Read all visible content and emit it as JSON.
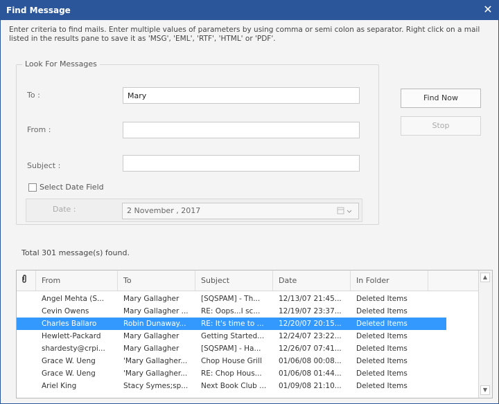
{
  "window": {
    "title": "Find Message",
    "close_glyph": "✕",
    "description": "Enter criteria to find mails. Enter multiple values of parameters by using comma or semi colon as separator. Right click on a mail listed in the results pane to save it as 'MSG', 'EML', 'RTF', 'HTML' or 'PDF'."
  },
  "search": {
    "group_title": "Look For Messages",
    "to_label": "To :",
    "to_value": "Mary",
    "from_label": "From :",
    "from_value": "",
    "subject_label": "Subject :",
    "subject_value": "",
    "date_checkbox_label": "Select Date Field",
    "date_checked": false,
    "date_label": "Date :",
    "date_value": "2 November , 2017",
    "date_picker_icon": "calendar-dropdown-icon"
  },
  "buttons": {
    "find_now": "Find Now",
    "stop": "Stop"
  },
  "results": {
    "status": "Total 301 message(s) found.",
    "columns": [
      "",
      "From",
      "To",
      "Subject",
      "Date",
      "In Folder"
    ],
    "attachment_icon": "paperclip-icon",
    "rows": [
      {
        "from": "Angel Mehta (S...",
        "to": "Mary Gallagher",
        "subject": "[SQSPAM] - Th...",
        "date": "12/13/07 21:45...",
        "folder": "Deleted Items"
      },
      {
        "from": "Cevin Owens",
        "to": "Mary Gallagher ...",
        "subject": "RE: Oops...I sc...",
        "date": "12/19/07 23:37...",
        "folder": "Deleted Items"
      },
      {
        "from": "Charles Ballaro",
        "to": "Robin Dunaway...",
        "subject": "RE: It's time to ...",
        "date": "12/20/07 20:15...",
        "folder": "Deleted Items"
      },
      {
        "from": "Hewlett-Packard",
        "to": "Mary Gallagher",
        "subject": "Getting Started...",
        "date": "12/24/07 23:22...",
        "folder": "Deleted Items"
      },
      {
        "from": "shardesty@crpi...",
        "to": "Mary Gallagher",
        "subject": "[SQSPAM] - Ha...",
        "date": "12/26/07 07:41...",
        "folder": "Deleted Items"
      },
      {
        "from": "Grace W. Ueng",
        "to": "'Mary Gallagher...",
        "subject": "Chop House Grill",
        "date": "01/06/08 00:08...",
        "folder": "Deleted Items"
      },
      {
        "from": "Grace W. Ueng",
        "to": "'Mary Gallagher...",
        "subject": "RE: Chop Hous...",
        "date": "01/06/08 01:44...",
        "folder": "Deleted Items"
      },
      {
        "from": "Ariel King",
        "to": "Stacy Symes;sp...",
        "subject": "Next Book Club ...",
        "date": "01/09/08 21:10...",
        "folder": "Deleted Items"
      }
    ],
    "selected_row": 2
  },
  "colors": {
    "title_bar": "#2b579a",
    "selection": "#3399ff"
  }
}
